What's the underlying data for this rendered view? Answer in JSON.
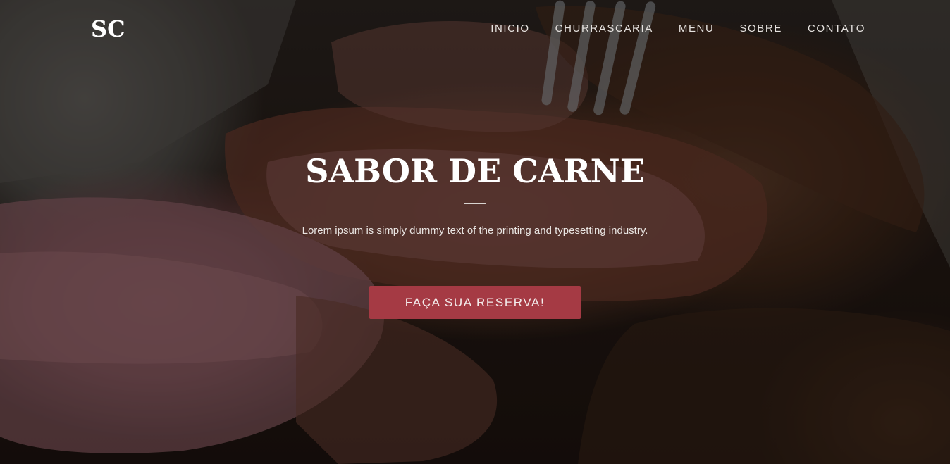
{
  "brand": {
    "logo_text": "SC"
  },
  "nav": {
    "items": [
      {
        "label": "INICIO"
      },
      {
        "label": "CHURRASCARIA"
      },
      {
        "label": "MENU"
      },
      {
        "label": "SOBRE"
      },
      {
        "label": "CONTATO"
      }
    ]
  },
  "hero": {
    "title": "SABOR DE CARNE",
    "subtitle": "Lorem ipsum is simply dummy text of the printing and typesetting industry.",
    "cta_label": "FAÇA SUA RESERVA!",
    "background": "grilled-meat-photo"
  },
  "colors": {
    "accent": "#a53a44",
    "text_light": "#ffffff"
  }
}
